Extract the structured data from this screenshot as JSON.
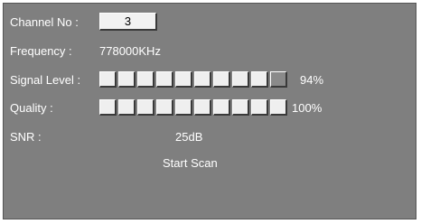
{
  "channel": {
    "label": "Channel No :",
    "value": "3"
  },
  "frequency": {
    "label": "Frequency :",
    "value": "778000KHz"
  },
  "signal_level": {
    "label": "Signal Level :",
    "value_text": "94%",
    "level": 0.94,
    "segments": 10
  },
  "quality": {
    "label": "Quality :",
    "value_text": "100%",
    "level": 1.0,
    "segments": 10
  },
  "snr": {
    "label": "SNR :",
    "value": "25dB"
  },
  "actions": {
    "start_scan": "Start Scan"
  },
  "colors": {
    "panel_bg": "#7f7f7f",
    "text": "#ffffff",
    "segment_on": "#efefef",
    "segment_off": "#8a8a8a"
  }
}
